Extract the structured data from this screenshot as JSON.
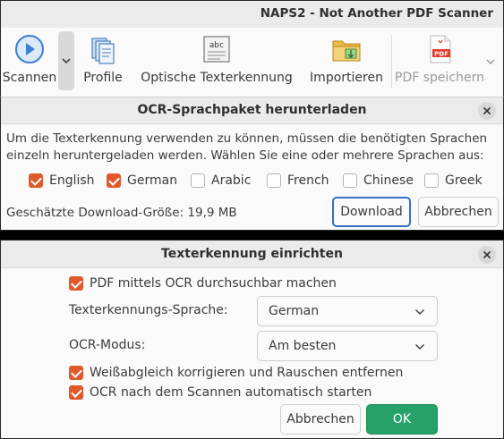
{
  "app": {
    "title": "NAPS2 - Not Another PDF Scanner",
    "toolbar": {
      "scan_label": "Scannen",
      "profiles_label": "Profile",
      "ocr_label": "Optische Texterkennung",
      "import_label": "Importieren",
      "save_pdf_label": "PDF speichern"
    }
  },
  "download_dialog": {
    "title": "OCR-Sprachpaket herunterladen",
    "message": "Um die Texterkennung verwenden zu können, müssen die benötigten Sprachen einzeln heruntergeladen werden. Wählen Sie eine oder mehrere Sprachen aus:",
    "languages": [
      {
        "label": "English",
        "checked": true
      },
      {
        "label": "German",
        "checked": true
      },
      {
        "label": "Arabic",
        "checked": false
      },
      {
        "label": "French",
        "checked": false
      },
      {
        "label": "Chinese",
        "checked": false
      },
      {
        "label": "Greek",
        "checked": false
      }
    ],
    "download_size": "Geschätzte Download-Größe: 19,9 MB",
    "download_button": "Download",
    "cancel_button": "Abbrechen"
  },
  "ocr_dialog": {
    "title": "Texterkennung einrichten",
    "searchable_pdf": {
      "label": "PDF mittels OCR durchsuchbar machen",
      "checked": true
    },
    "language_label": "Texterkennungs-Sprache:",
    "language_value": "German",
    "mode_label": "OCR-Modus:",
    "mode_value": "Am besten",
    "whitebalance": {
      "label": "Weißabgleich korrigieren und Rauschen entfernen",
      "checked": true
    },
    "auto_ocr": {
      "label": "OCR nach dem Scannen automatisch starten",
      "checked": true
    },
    "cancel_button": "Abbrechen",
    "ok_button": "OK"
  },
  "colors": {
    "accent_orange": "#e0592a",
    "ok_green": "#26a269",
    "focus_blue": "#3a6fbf"
  }
}
